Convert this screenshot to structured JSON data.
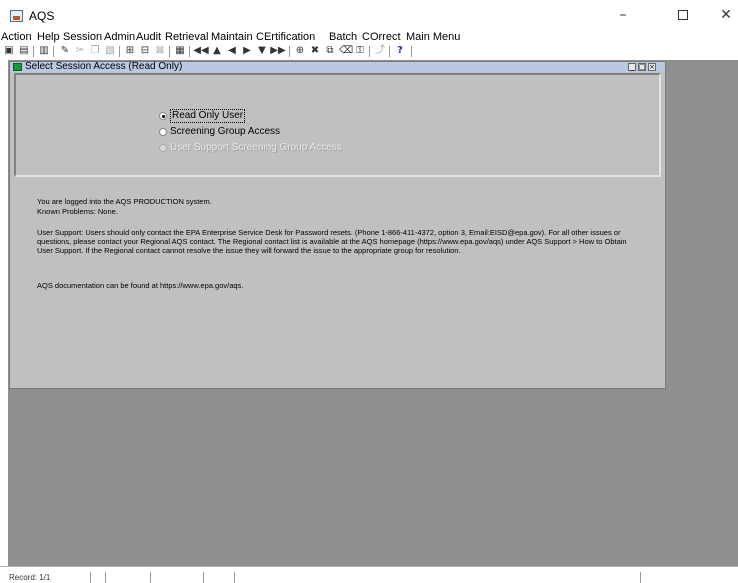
{
  "window": {
    "title": "AQS",
    "minimize_glyph": "–",
    "close_glyph": "✕"
  },
  "menu": [
    {
      "label": "Action"
    },
    {
      "label": "Help"
    },
    {
      "label": "Session"
    },
    {
      "label": "Admin"
    },
    {
      "label": "Audit"
    },
    {
      "label": "Retrieval"
    },
    {
      "label": "Maintain"
    },
    {
      "label": "CErtification"
    },
    {
      "label": "Batch"
    },
    {
      "label": "COrrect"
    },
    {
      "label": "Main Menu"
    }
  ],
  "toolbar": {
    "icons": [
      {
        "name": "save-icon",
        "glyph": "▣"
      },
      {
        "name": "print-icon",
        "glyph": "▤"
      },
      {
        "name": "exit-icon",
        "glyph": "▥"
      },
      {
        "name": "edit-icon",
        "glyph": "✎"
      },
      {
        "name": "cut-icon",
        "glyph": "✂"
      },
      {
        "name": "copy-icon",
        "glyph": "❐"
      },
      {
        "name": "paste-icon",
        "glyph": "▧"
      },
      {
        "name": "query-icon",
        "glyph": "⊞"
      },
      {
        "name": "execute-query-icon",
        "glyph": "⊟"
      },
      {
        "name": "cancel-query-icon",
        "glyph": "⊠"
      },
      {
        "name": "list-icon",
        "glyph": "▦"
      },
      {
        "name": "first-record-icon",
        "glyph": "◀◀"
      },
      {
        "name": "prev-set-icon",
        "glyph": "▲"
      },
      {
        "name": "prev-record-icon",
        "glyph": "◀"
      },
      {
        "name": "next-record-icon",
        "glyph": "▶"
      },
      {
        "name": "next-set-icon",
        "glyph": "▼"
      },
      {
        "name": "last-record-icon",
        "glyph": "▶▶"
      },
      {
        "name": "insert-record-icon",
        "glyph": "⊕"
      },
      {
        "name": "delete-record-icon",
        "glyph": "✖"
      },
      {
        "name": "duplicate-record-icon",
        "glyph": "⧉"
      },
      {
        "name": "clear-icon",
        "glyph": "⌫"
      },
      {
        "name": "lock-icon",
        "glyph": "⚿"
      },
      {
        "name": "help-hint-icon",
        "glyph": "⤴"
      },
      {
        "name": "help-icon",
        "glyph": "?"
      }
    ]
  },
  "form": {
    "title": "Select Session Access (Read Only)",
    "options": [
      {
        "label": "Read Only User",
        "selected": true,
        "enabled": true
      },
      {
        "label": "Screening Group Access",
        "selected": false,
        "enabled": true
      },
      {
        "label": "User Support Screening Group Access",
        "selected": false,
        "enabled": false
      }
    ],
    "messages": {
      "line1": "You are logged into the AQS PRODUCTION system.",
      "line2": "Known Problems:  None.",
      "support": "User Support:  Users should only contact the EPA Enterprise Service Desk for Password resets. (Phone 1-866-411-4372, option 3, Email:EISD@epa.gov).  For all other issues or questions, please contact your Regional AQS contact.  The Regional contact list is available at the AQS homepage (https://www.epa.gov/aqs) under AQS Support > How to Obtain User Support. If the Regional contact cannot resolve the issue they will forward the issue to the appropriate group for resolution.",
      "docs": "AQS documentation can be found at https://www.epa.gov/aqs."
    }
  },
  "status": {
    "record": "Record: 1/1"
  }
}
